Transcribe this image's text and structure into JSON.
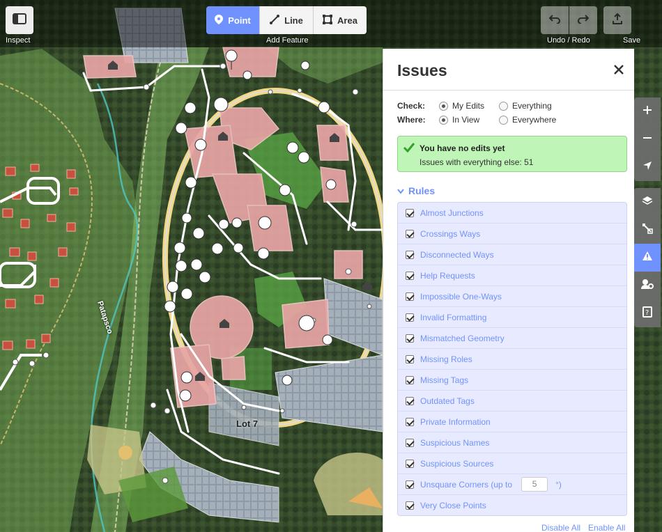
{
  "toolbar": {
    "inspect_label": "Inspect",
    "add_feature_label": "Add Feature",
    "point_label": "Point",
    "line_label": "Line",
    "area_label": "Area",
    "undo_redo_label": "Undo / Redo",
    "save_label": "Save"
  },
  "map": {
    "labels": {
      "lot": "Lot 7",
      "river": "Patapsco"
    },
    "colors": {
      "highlight_road": "#f3d985",
      "building": "#e8a5a5",
      "park": "#8fcf6a",
      "accent": "#7092ff"
    }
  },
  "issues": {
    "title": "Issues",
    "check_label": "Check:",
    "where_label": "Where:",
    "check_options": [
      {
        "label": "My Edits",
        "checked": true
      },
      {
        "label": "Everything",
        "checked": false
      }
    ],
    "where_options": [
      {
        "label": "In View",
        "checked": true
      },
      {
        "label": "Everywhere",
        "checked": false
      }
    ],
    "success_title": "You have no edits yet",
    "success_detail": "Issues with everything else: 51",
    "rules_heading": "Rules",
    "rules": [
      "Almost Junctions",
      "Crossings Ways",
      "Disconnected Ways",
      "Help Requests",
      "Impossible One-Ways",
      "Invalid Formatting",
      "Mismatched Geometry",
      "Missing Roles",
      "Missing Tags",
      "Outdated Tags",
      "Private Information",
      "Suspicious Names",
      "Suspicious Sources",
      "Unsquare Corners (up to",
      "Very Close Points"
    ],
    "unsquare_degrees": "5",
    "unsquare_suffix": "°)",
    "disable_all": "Disable All",
    "enable_all": "Enable All"
  }
}
